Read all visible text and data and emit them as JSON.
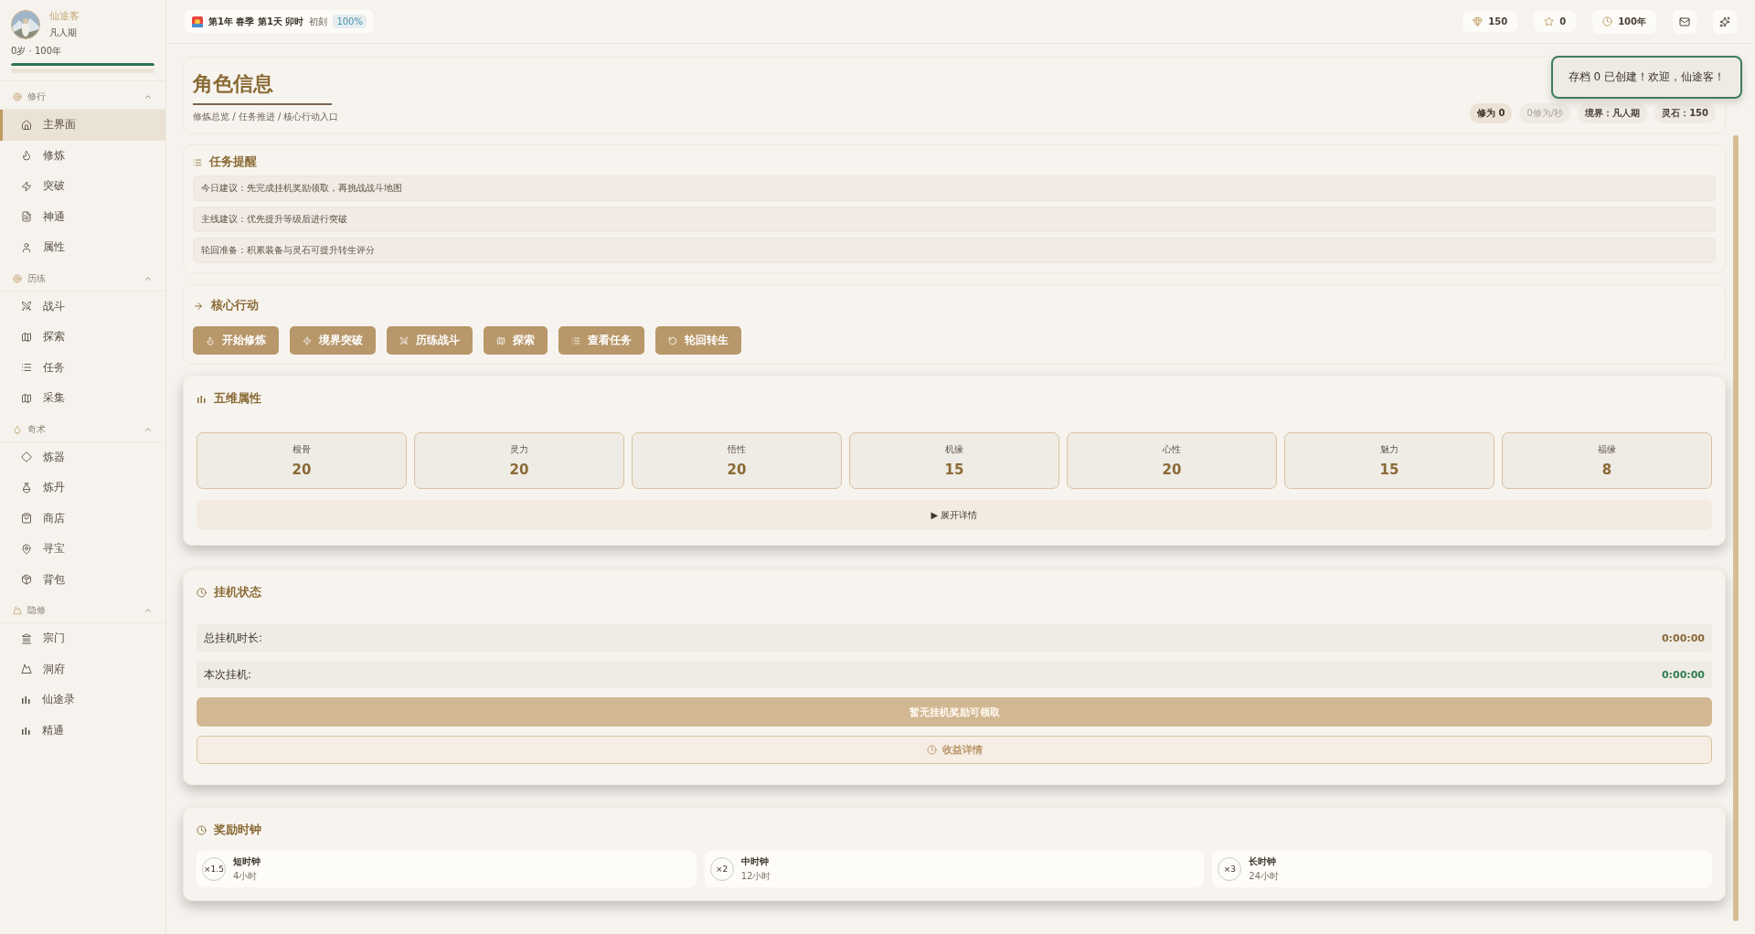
{
  "profile": {
    "name": "仙途客",
    "realm": "凡人期",
    "age": "0岁",
    "sep": "·",
    "lifespan": "100年",
    "bar": {
      "level": 1
    }
  },
  "nav": [
    {
      "title": "修行",
      "expanded": true,
      "items": [
        {
          "label": "主界面",
          "selected": true
        },
        {
          "label": "修炼",
          "selected": false
        },
        {
          "label": "突破",
          "selected": false
        },
        {
          "label": "神通",
          "selected": false
        },
        {
          "label": "属性",
          "selected": false
        }
      ]
    },
    {
      "title": "历练",
      "expanded": true,
      "items": [
        {
          "label": "战斗",
          "selected": false
        },
        {
          "label": "探索",
          "selected": false
        },
        {
          "label": "任务",
          "selected": false
        },
        {
          "label": "采集",
          "selected": false
        }
      ]
    },
    {
      "title": "奇术",
      "expanded": true,
      "items": [
        {
          "label": "炼器",
          "selected": false
        },
        {
          "label": "炼丹",
          "selected": false
        },
        {
          "label": "商店",
          "selected": false
        },
        {
          "label": "寻宝",
          "selected": false
        },
        {
          "label": "背包",
          "selected": false
        }
      ]
    },
    {
      "title": "隐修",
      "expanded": true,
      "items": [
        {
          "label": "宗门",
          "selected": false
        },
        {
          "label": "洞府",
          "selected": false
        },
        {
          "label": "仙途录",
          "selected": false
        },
        {
          "label": "精通",
          "selected": false
        }
      ]
    }
  ],
  "topbar": {
    "date": "第1年 春季 第1天 卯时",
    "moment": "初刻",
    "speed": "100%",
    "stats": [
      "150",
      "0",
      "100年"
    ]
  },
  "toast": "存档 0 已创建！欢迎，仙途客！",
  "header": {
    "title": "角色信息",
    "subtitle": "修炼总览 / 任务推进 / 核心行动入口",
    "tags": [
      {
        "text": "修为 0",
        "kind": "strong"
      },
      {
        "text": "0修为/秒",
        "kind": "muted"
      },
      {
        "text": "境界：凡人期",
        "kind": "normal"
      },
      {
        "text": "灵石：150",
        "kind": "normal"
      }
    ]
  },
  "tasks": {
    "title": "任务提醒",
    "items": [
      "今日建议：先完成挂机奖励领取，再挑战战斗地图",
      "主线建议：优先提升等级后进行突破",
      "轮回准备：积累装备与灵石可提升转生评分"
    ]
  },
  "actions": {
    "title": "核心行动",
    "buttons": [
      "开始修炼",
      "境界突破",
      "历练战斗",
      "探索",
      "查看任务",
      "轮回转生"
    ]
  },
  "attributes": {
    "title": "五维属性",
    "stats": [
      {
        "name": "根骨",
        "value": "20"
      },
      {
        "name": "灵力",
        "value": "20"
      },
      {
        "name": "悟性",
        "value": "20"
      },
      {
        "name": "机缘",
        "value": "15"
      },
      {
        "name": "心性",
        "value": "20"
      },
      {
        "name": "魅力",
        "value": "15"
      },
      {
        "name": "福缘",
        "value": "8"
      }
    ],
    "expand": "▶ 展开详情"
  },
  "idle": {
    "title": "挂机状态",
    "rows": [
      {
        "label": "总挂机时长:",
        "value": "0:00:00",
        "color": "#8a6a35"
      },
      {
        "label": "本次挂机:",
        "value": "0:00:00",
        "color": "#2e7d4f"
      }
    ],
    "claim": {
      "label": "暂无挂机奖励可领取",
      "disabled": true
    },
    "details": "收益详情"
  },
  "clocks": {
    "title": "奖励时钟",
    "items": [
      {
        "mult": "×1.5",
        "name": "短时钟",
        "time": "4小时"
      },
      {
        "mult": "×2",
        "name": "中时钟",
        "time": "12小时"
      },
      {
        "mult": "×3",
        "name": "长时钟",
        "time": "24小时"
      }
    ]
  }
}
